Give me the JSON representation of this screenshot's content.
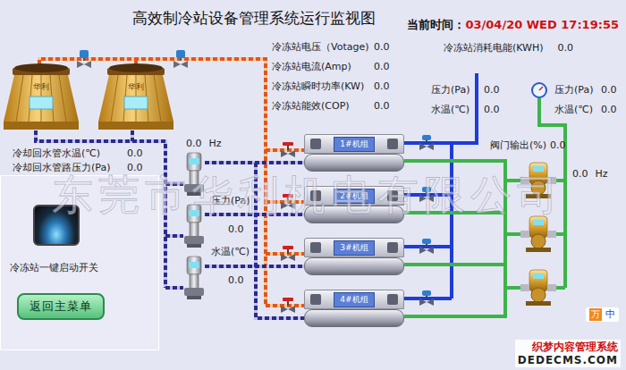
{
  "window": {
    "title": "高效制冷站设备管理系统运行监视图"
  },
  "clock": {
    "label": "当前时间：",
    "value": "03/04/20 WED 17:19:55"
  },
  "station": {
    "readings": [
      {
        "label": "冷冻站电压（Votage)",
        "value": "0.0"
      },
      {
        "label": "冷冻站电流(Amp)",
        "value": "0.0"
      },
      {
        "label": "冷冻站瞬时功率(KW)",
        "value": "0.0"
      },
      {
        "label": "冷冻站能效(COP)",
        "value": "0.0"
      }
    ],
    "energy": {
      "label": "冷冻站消耗电能(KWH)",
      "value": "0.0"
    }
  },
  "cooling_towers": [
    {
      "brand": "华利"
    },
    {
      "brand": "华利"
    }
  ],
  "cooling_return": [
    {
      "label": "冷却回水管水温(℃)",
      "value": "0.0"
    },
    {
      "label": "冷却回水管路压力(Pa)",
      "value": "0.0"
    }
  ],
  "cooling_pumps": {
    "frequency": "0.0",
    "unit": "Hz"
  },
  "condenser_sensors": [
    {
      "label": "压力(Pa)",
      "value": "0.0"
    },
    {
      "label": "水温(℃)",
      "value": "0.0"
    }
  ],
  "chillers": [
    {
      "name": "1#机组"
    },
    {
      "name": "2#机组"
    },
    {
      "name": "3#机组"
    },
    {
      "name": "4#机组"
    }
  ],
  "chilled_sensors": [
    {
      "label": "压力(Pa)",
      "value": "0.0"
    },
    {
      "label": "水温(℃)",
      "value": "0.0"
    }
  ],
  "return_sensors": [
    {
      "label": "压力(Pa)",
      "value": "0.0"
    },
    {
      "label": "水温(℃)",
      "value": "0.0"
    }
  ],
  "valve": {
    "label": "阀门输出(%)",
    "value": "0.0"
  },
  "chilled_pumps": {
    "frequency": "0.0",
    "unit": "Hz"
  },
  "switch": {
    "label": "冷冻站一键启动开关"
  },
  "buttons": [
    "返回主菜单"
  ],
  "watermark": "东莞市华利机电有限公司",
  "site_mark": {
    "name": "织梦内容管理系统",
    "url": "DEDECMS.COM"
  },
  "badge": {
    "icon": "万",
    "text": "中"
  }
}
